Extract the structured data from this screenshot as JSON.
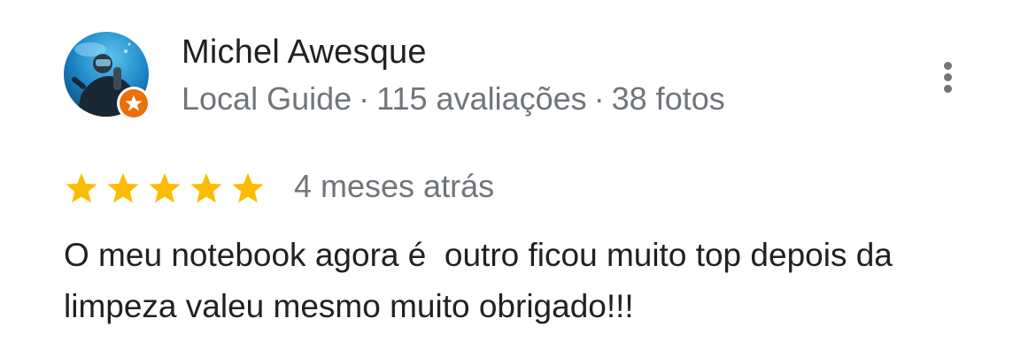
{
  "review": {
    "author": {
      "name": "Michel Awesque",
      "badge": "Local Guide",
      "reviews_count": "115 avaliações",
      "photos_count": "38 fotos",
      "separator": "·",
      "avatar_icon": "scuba-diver-photo",
      "badge_icon": "local-guide-star-badge"
    },
    "rating": 5,
    "max_rating": 5,
    "time_ago": "4 meses atrás",
    "text": "O meu notebook agora é  outro ficou muito top depois da limpeza valeu mesmo muito obrigado!!!",
    "menu_icon": "more-vert-icon"
  },
  "colors": {
    "star": "#fbbc04",
    "star_empty": "#dadce0",
    "badge": "#e8710a",
    "primary_text": "#202124",
    "secondary_text": "#70757a"
  }
}
